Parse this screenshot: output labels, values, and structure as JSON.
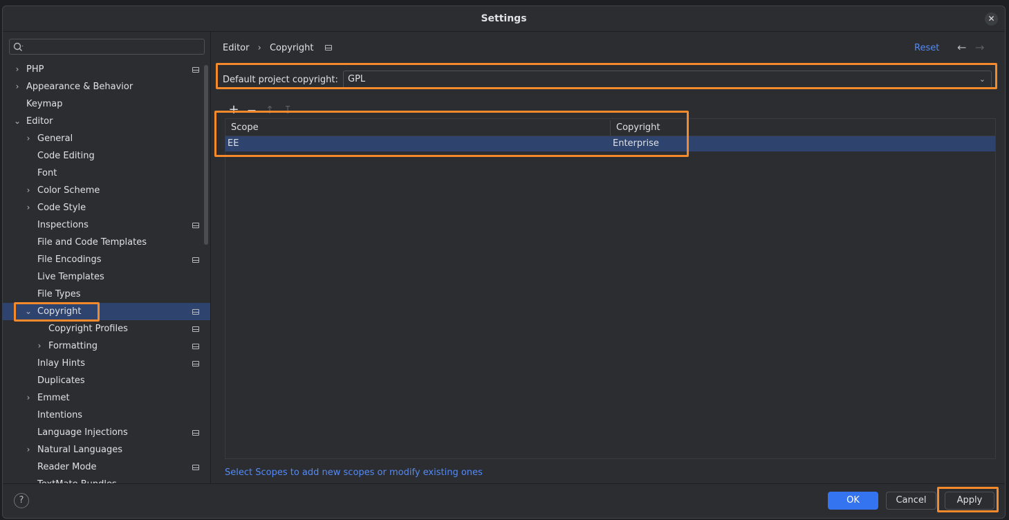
{
  "window": {
    "title": "Settings",
    "close_glyph": "✕"
  },
  "sidebar": {
    "search": {
      "placeholder": "",
      "icon": "search-icon"
    },
    "items": [
      {
        "label": "PHP",
        "chevron": "›",
        "level": 0,
        "project_icon": true
      },
      {
        "label": "Appearance & Behavior",
        "chevron": "›",
        "level": 0,
        "project_icon": false
      },
      {
        "label": "Keymap",
        "chevron": "",
        "level": 0,
        "project_icon": false
      },
      {
        "label": "Editor",
        "chevron": "⌄",
        "level": 0,
        "project_icon": false
      },
      {
        "label": "General",
        "chevron": "›",
        "level": 1,
        "project_icon": false
      },
      {
        "label": "Code Editing",
        "chevron": "",
        "level": 1,
        "project_icon": false
      },
      {
        "label": "Font",
        "chevron": "",
        "level": 1,
        "project_icon": false
      },
      {
        "label": "Color Scheme",
        "chevron": "›",
        "level": 1,
        "project_icon": false
      },
      {
        "label": "Code Style",
        "chevron": "›",
        "level": 1,
        "project_icon": false
      },
      {
        "label": "Inspections",
        "chevron": "",
        "level": 1,
        "project_icon": true
      },
      {
        "label": "File and Code Templates",
        "chevron": "",
        "level": 1,
        "project_icon": false
      },
      {
        "label": "File Encodings",
        "chevron": "",
        "level": 1,
        "project_icon": true
      },
      {
        "label": "Live Templates",
        "chevron": "",
        "level": 1,
        "project_icon": false
      },
      {
        "label": "File Types",
        "chevron": "",
        "level": 1,
        "project_icon": false
      },
      {
        "label": "Copyright",
        "chevron": "⌄",
        "level": 1,
        "project_icon": true,
        "selected": true
      },
      {
        "label": "Copyright Profiles",
        "chevron": "",
        "level": 2,
        "project_icon": true
      },
      {
        "label": "Formatting",
        "chevron": "›",
        "level": 2,
        "project_icon": true
      },
      {
        "label": "Inlay Hints",
        "chevron": "",
        "level": 1,
        "project_icon": true
      },
      {
        "label": "Duplicates",
        "chevron": "",
        "level": 1,
        "project_icon": false
      },
      {
        "label": "Emmet",
        "chevron": "›",
        "level": 1,
        "project_icon": false
      },
      {
        "label": "Intentions",
        "chevron": "",
        "level": 1,
        "project_icon": false
      },
      {
        "label": "Language Injections",
        "chevron": "",
        "level": 1,
        "project_icon": true
      },
      {
        "label": "Natural Languages",
        "chevron": "›",
        "level": 1,
        "project_icon": false
      },
      {
        "label": "Reader Mode",
        "chevron": "",
        "level": 1,
        "project_icon": true
      },
      {
        "label": "TextMate Bundles",
        "chevron": "",
        "level": 1,
        "project_icon": false
      }
    ]
  },
  "breadcrumb": {
    "parent": "Editor",
    "separator": "›",
    "current": "Copyright"
  },
  "header": {
    "reset_label": "Reset",
    "back_glyph": "←",
    "forward_glyph": "→"
  },
  "default_copyright": {
    "label": "Default project copyright:",
    "value": "GPL",
    "arrow": "⌄"
  },
  "toolbar": {
    "add": "+",
    "remove": "—",
    "up": "↑",
    "down": "↧"
  },
  "table": {
    "columns": [
      "Scope",
      "Copyright"
    ],
    "rows": [
      {
        "scope": "EE",
        "copyright": "Enterprise"
      }
    ]
  },
  "hint_link": "Select Scopes to add new scopes or modify existing ones",
  "footer": {
    "help": "?",
    "ok": "OK",
    "cancel": "Cancel",
    "apply": "Apply"
  },
  "colors": {
    "accent": "#3574f0",
    "highlight": "#f58a2c",
    "selection": "#2e436e",
    "link": "#548af7"
  }
}
